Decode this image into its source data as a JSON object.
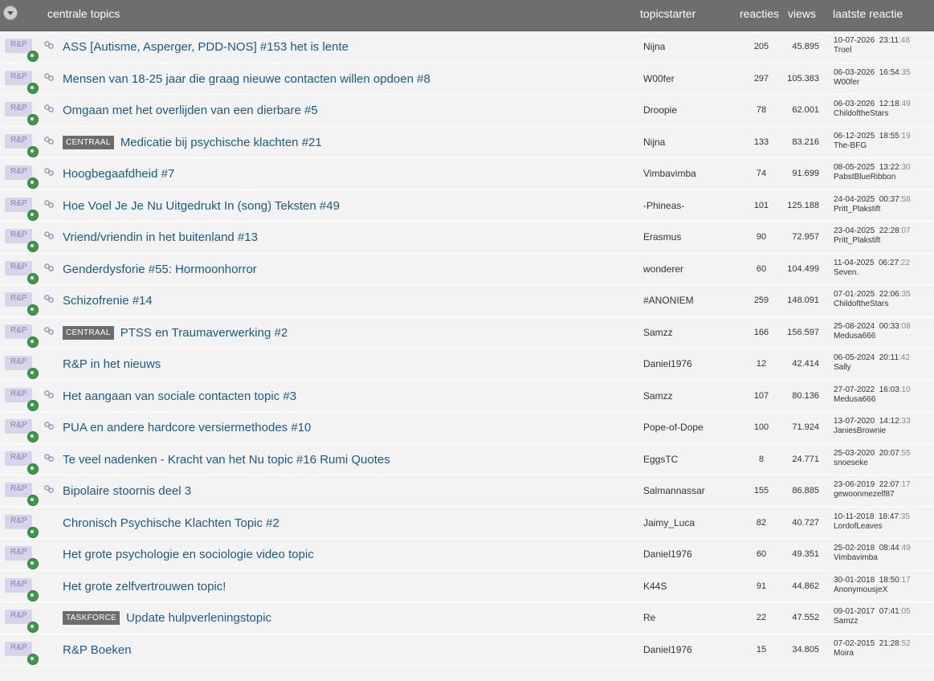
{
  "header": {
    "title": "centrale topics",
    "starter": "topicstarter",
    "reacties": "reacties",
    "views": "views",
    "last": "laatste reactie"
  },
  "category_label": "R&P",
  "topics": [
    {
      "tag": "",
      "title": "ASS [Autisme, Asperger, PDD-NOS] #153 het is lente",
      "starter": "Nijna",
      "reacties": "205",
      "views": "45.895",
      "date": "10-07-2026",
      "time": "23:11",
      "sec": ":48",
      "by": "Troel",
      "link": true
    },
    {
      "tag": "",
      "title": "Mensen van 18-25 jaar die graag nieuwe contacten willen opdoen #8",
      "starter": "W00fer",
      "reacties": "297",
      "views": "105.383",
      "date": "06-03-2026",
      "time": "16:54",
      "sec": ":35",
      "by": "W00fer",
      "link": true
    },
    {
      "tag": "",
      "title": "Omgaan met het overlijden van een dierbare #5",
      "starter": "Droopie",
      "reacties": "78",
      "views": "62.001",
      "date": "06-03-2026",
      "time": "12:18",
      "sec": ":49",
      "by": "ChildoftheStars",
      "link": true
    },
    {
      "tag": "CENTRAAL",
      "title": "Medicatie bij psychische klachten #21",
      "starter": "Nijna",
      "reacties": "133",
      "views": "83.216",
      "date": "06-12-2025",
      "time": "18:55",
      "sec": ":19",
      "by": "The-BFG",
      "link": true
    },
    {
      "tag": "",
      "title": "Hoogbegaafdheid #7",
      "starter": "Vimbavimba",
      "reacties": "74",
      "views": "91.699",
      "date": "08-05-2025",
      "time": "13:22",
      "sec": ":30",
      "by": "PabstBlueRibbon",
      "link": true
    },
    {
      "tag": "",
      "title": "Hoe Voel Je Je Nu Uitgedrukt In (song) Teksten #49",
      "starter": "-Phineas-",
      "reacties": "101",
      "views": "125.188",
      "date": "24-04-2025",
      "time": "00:37",
      "sec": ":58",
      "by": "Pritt_Plakstift",
      "link": true
    },
    {
      "tag": "",
      "title": "Vriend/vriendin in het buitenland #13",
      "starter": "Erasmus",
      "reacties": "90",
      "views": "72.957",
      "date": "23-04-2025",
      "time": "22:28",
      "sec": ":07",
      "by": "Pritt_Plakstift",
      "link": true
    },
    {
      "tag": "",
      "title": "Genderdysforie #55: Hormoonhorror",
      "starter": "wonderer",
      "reacties": "60",
      "views": "104.499",
      "date": "11-04-2025",
      "time": "06:27",
      "sec": ":22",
      "by": "Seven.",
      "link": true
    },
    {
      "tag": "",
      "title": "Schizofrenie #14",
      "starter": "#ANONIEM",
      "reacties": "259",
      "views": "148.091",
      "date": "07-01-2025",
      "time": "22:06",
      "sec": ":35",
      "by": "ChildoftheStars",
      "link": true
    },
    {
      "tag": "CENTRAAL",
      "title": "PTSS en Traumaverwerking #2",
      "starter": "Samzz",
      "reacties": "166",
      "views": "156.597",
      "date": "25-08-2024",
      "time": "00:33",
      "sec": ":08",
      "by": "Medusa666",
      "link": true
    },
    {
      "tag": "",
      "title": "R&P in het nieuws",
      "starter": "Daniel1976",
      "reacties": "12",
      "views": "42.414",
      "date": "06-05-2024",
      "time": "20:11",
      "sec": ":42",
      "by": "Sally",
      "link": false
    },
    {
      "tag": "",
      "title": "Het aangaan van sociale contacten topic #3",
      "starter": "Samzz",
      "reacties": "107",
      "views": "80.136",
      "date": "27-07-2022",
      "time": "16:03",
      "sec": ":10",
      "by": "Medusa666",
      "link": true
    },
    {
      "tag": "",
      "title": "PUA en andere hardcore versiermethodes #10",
      "starter": "Pope-of-Dope",
      "reacties": "100",
      "views": "71.924",
      "date": "13-07-2020",
      "time": "14:12",
      "sec": ":33",
      "by": "JaniesBrownie",
      "link": true
    },
    {
      "tag": "",
      "title": "Te veel nadenken - Kracht van het Nu topic #16 Rumi Quotes",
      "starter": "EggsTC",
      "reacties": "8",
      "views": "24.771",
      "date": "25-03-2020",
      "time": "20:07",
      "sec": ":55",
      "by": "snoeseke",
      "link": true
    },
    {
      "tag": "",
      "title": "Bipolaire stoornis deel 3",
      "starter": "Salmannassar",
      "reacties": "155",
      "views": "86.885",
      "date": "23-06-2019",
      "time": "22:07",
      "sec": ":17",
      "by": "gewoonmezelf87",
      "link": true
    },
    {
      "tag": "",
      "title": "Chronisch Psychische Klachten Topic #2",
      "starter": "Jaimy_Luca",
      "reacties": "82",
      "views": "40.727",
      "date": "10-11-2018",
      "time": "18:47",
      "sec": ":35",
      "by": "LordofLeaves",
      "link": false
    },
    {
      "tag": "",
      "title": "Het grote psychologie en sociologie video topic",
      "starter": "Daniel1976",
      "reacties": "60",
      "views": "49.351",
      "date": "25-02-2018",
      "time": "08:44",
      "sec": ":49",
      "by": "Vimbavimba",
      "link": false
    },
    {
      "tag": "",
      "title": "Het grote zelfvertrouwen topic!",
      "starter": "K44S",
      "reacties": "91",
      "views": "44.862",
      "date": "30-01-2018",
      "time": "18:50",
      "sec": ":17",
      "by": "AnonymousjeX",
      "link": false
    },
    {
      "tag": "TASKFORCE",
      "title": "Update hulpverleningstopic",
      "starter": "Re",
      "reacties": "22",
      "views": "47.552",
      "date": "09-01-2017",
      "time": "07:41",
      "sec": ":05",
      "by": "Samzz",
      "link": false
    },
    {
      "tag": "",
      "title": "R&P Boeken",
      "starter": "Daniel1976",
      "reacties": "15",
      "views": "34.805",
      "date": "07-02-2015",
      "time": "21:28",
      "sec": ":52",
      "by": "Moira",
      "link": false
    }
  ]
}
